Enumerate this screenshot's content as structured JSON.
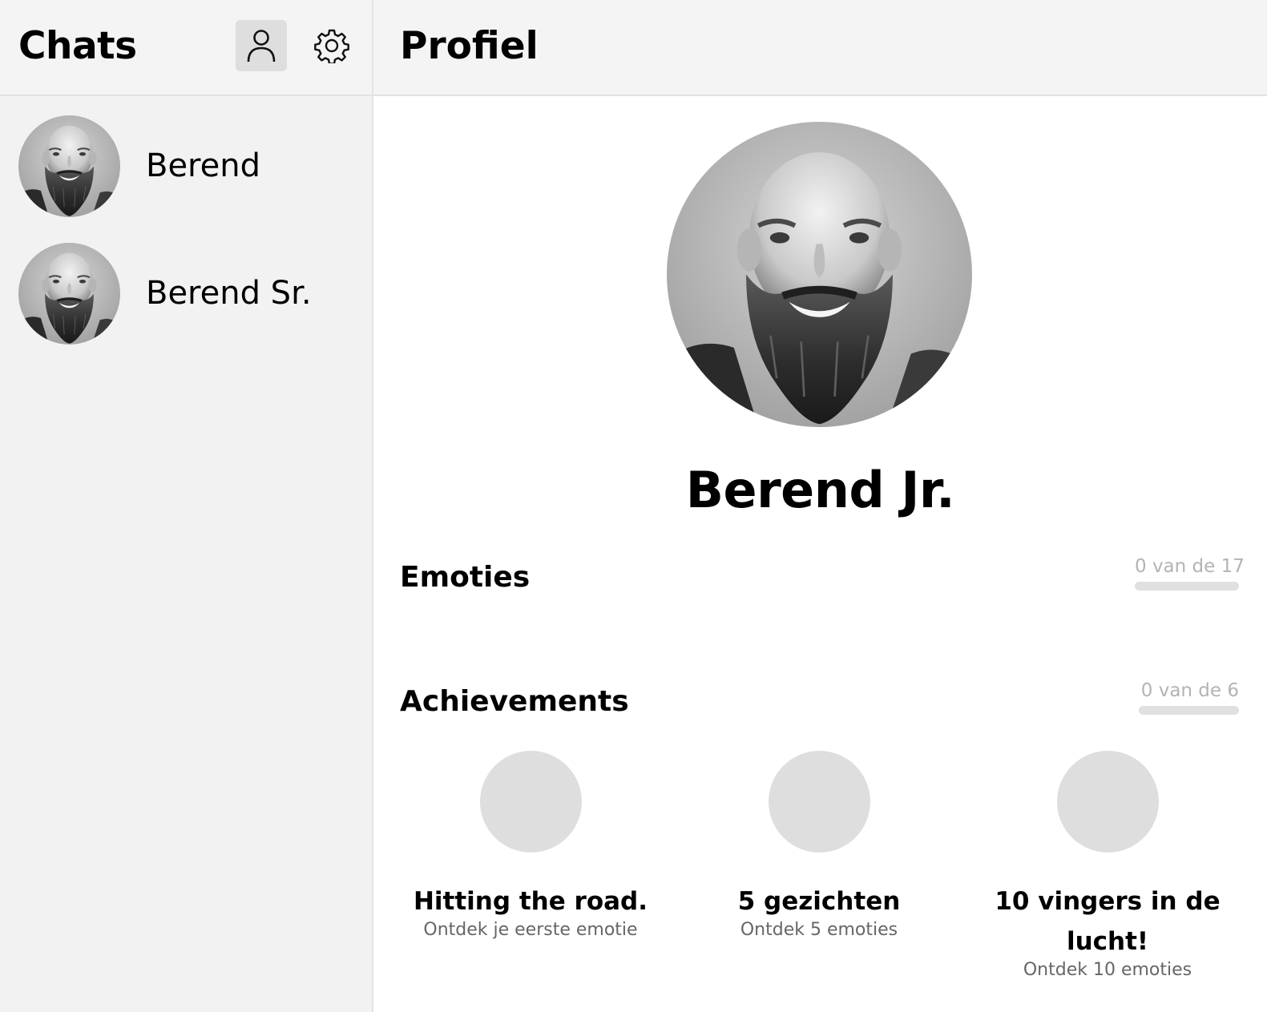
{
  "sidebar": {
    "title": "Chats",
    "chats": [
      {
        "name": "Berend"
      },
      {
        "name": "Berend Sr."
      }
    ]
  },
  "main": {
    "title": "Profiel",
    "profile_name": "Berend Jr.",
    "emotions": {
      "title": "Emoties",
      "progress_label": "0 van de 17",
      "progress_fraction": 0
    },
    "achievements": {
      "title": "Achievements",
      "progress_label": "0 van de 6",
      "progress_fraction": 0,
      "items": [
        {
          "title": "Hitting the road.",
          "subtitle": "Ontdek je eerste emotie"
        },
        {
          "title": "5 gezichten",
          "subtitle": "Ontdek 5 emoties"
        },
        {
          "title": "10 vingers in de lucht!",
          "subtitle": "Ontdek 10 emoties"
        }
      ]
    }
  },
  "icons": {
    "profile_button": "person-icon",
    "settings_button": "gear-icon"
  },
  "colors": {
    "sidebar_bg": "#f2f2f2",
    "header_bg": "#f4f4f4",
    "active_icon_bg": "#dedede",
    "placeholder_circle": "#dedede",
    "muted_text": "#b3b3b3"
  }
}
